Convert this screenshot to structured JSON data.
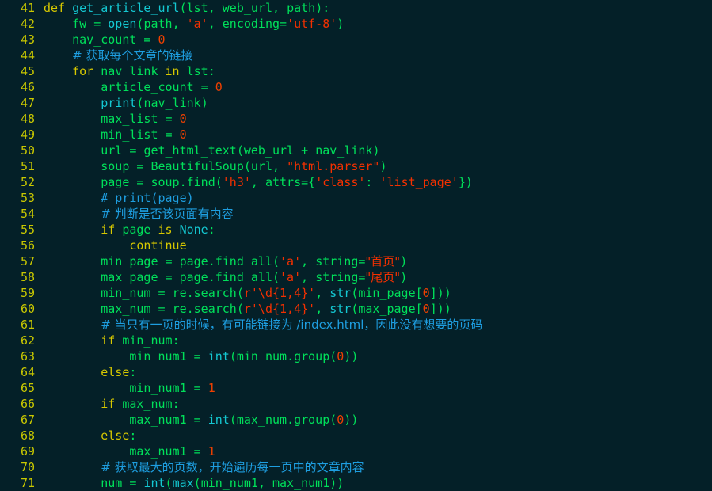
{
  "editor": {
    "background": "#042028",
    "language": "python",
    "first_line_number": 41,
    "last_line_number": 71,
    "palette": {
      "line_number": "#c9c800",
      "keyword": "#d7c800",
      "function": "#14c8d2",
      "identifier": "#00e05a",
      "string": "#f33000",
      "number": "#f04000",
      "comment": "#1e9ee0",
      "background": "#042028"
    },
    "lines": [
      {
        "number": "41",
        "tokens": [
          {
            "t": "def",
            "c": "kw"
          },
          {
            "t": " ",
            "c": "pun"
          },
          {
            "t": "get_article_url",
            "c": "fn"
          },
          {
            "t": "(",
            "c": "pun"
          },
          {
            "t": "lst",
            "c": "id"
          },
          {
            "t": ", ",
            "c": "pun"
          },
          {
            "t": "web_url",
            "c": "id"
          },
          {
            "t": ", ",
            "c": "pun"
          },
          {
            "t": "path",
            "c": "id"
          },
          {
            "t": "):",
            "c": "pun"
          }
        ]
      },
      {
        "number": "42",
        "tokens": [
          {
            "t": "    ",
            "c": "pun"
          },
          {
            "t": "fw",
            "c": "id"
          },
          {
            "t": " = ",
            "c": "op"
          },
          {
            "t": "open",
            "c": "bi"
          },
          {
            "t": "(",
            "c": "pun"
          },
          {
            "t": "path",
            "c": "id"
          },
          {
            "t": ", ",
            "c": "pun"
          },
          {
            "t": "'a'",
            "c": "str"
          },
          {
            "t": ", ",
            "c": "pun"
          },
          {
            "t": "encoding",
            "c": "id"
          },
          {
            "t": "=",
            "c": "op"
          },
          {
            "t": "'utf-8'",
            "c": "str"
          },
          {
            "t": ")",
            "c": "pun"
          }
        ]
      },
      {
        "number": "43",
        "tokens": [
          {
            "t": "    ",
            "c": "pun"
          },
          {
            "t": "nav_count",
            "c": "id"
          },
          {
            "t": " = ",
            "c": "op"
          },
          {
            "t": "0",
            "c": "num"
          }
        ]
      },
      {
        "number": "44",
        "tokens": [
          {
            "t": "    ",
            "c": "pun"
          },
          {
            "t": "# 获取每个文章的链接",
            "c": "com"
          }
        ]
      },
      {
        "number": "45",
        "tokens": [
          {
            "t": "    ",
            "c": "pun"
          },
          {
            "t": "for",
            "c": "kw"
          },
          {
            "t": " ",
            "c": "pun"
          },
          {
            "t": "nav_link",
            "c": "id"
          },
          {
            "t": " ",
            "c": "pun"
          },
          {
            "t": "in",
            "c": "kw"
          },
          {
            "t": " ",
            "c": "pun"
          },
          {
            "t": "lst",
            "c": "id"
          },
          {
            "t": ":",
            "c": "pun"
          }
        ]
      },
      {
        "number": "46",
        "tokens": [
          {
            "t": "        ",
            "c": "pun"
          },
          {
            "t": "article_count",
            "c": "id"
          },
          {
            "t": " = ",
            "c": "op"
          },
          {
            "t": "0",
            "c": "num"
          }
        ]
      },
      {
        "number": "47",
        "tokens": [
          {
            "t": "        ",
            "c": "pun"
          },
          {
            "t": "print",
            "c": "bi"
          },
          {
            "t": "(",
            "c": "pun"
          },
          {
            "t": "nav_link",
            "c": "id"
          },
          {
            "t": ")",
            "c": "pun"
          }
        ]
      },
      {
        "number": "48",
        "tokens": [
          {
            "t": "        ",
            "c": "pun"
          },
          {
            "t": "max_list",
            "c": "id"
          },
          {
            "t": " = ",
            "c": "op"
          },
          {
            "t": "0",
            "c": "num"
          }
        ]
      },
      {
        "number": "49",
        "tokens": [
          {
            "t": "        ",
            "c": "pun"
          },
          {
            "t": "min_list",
            "c": "id"
          },
          {
            "t": " = ",
            "c": "op"
          },
          {
            "t": "0",
            "c": "num"
          }
        ]
      },
      {
        "number": "50",
        "tokens": [
          {
            "t": "        ",
            "c": "pun"
          },
          {
            "t": "url",
            "c": "id"
          },
          {
            "t": " = ",
            "c": "op"
          },
          {
            "t": "get_html_text",
            "c": "id"
          },
          {
            "t": "(",
            "c": "pun"
          },
          {
            "t": "web_url",
            "c": "id"
          },
          {
            "t": " + ",
            "c": "op"
          },
          {
            "t": "nav_link",
            "c": "id"
          },
          {
            "t": ")",
            "c": "pun"
          }
        ]
      },
      {
        "number": "51",
        "tokens": [
          {
            "t": "        ",
            "c": "pun"
          },
          {
            "t": "soup",
            "c": "id"
          },
          {
            "t": " = ",
            "c": "op"
          },
          {
            "t": "BeautifulSoup",
            "c": "id"
          },
          {
            "t": "(",
            "c": "pun"
          },
          {
            "t": "url",
            "c": "id"
          },
          {
            "t": ", ",
            "c": "pun"
          },
          {
            "t": "\"html.parser\"",
            "c": "str"
          },
          {
            "t": ")",
            "c": "pun"
          }
        ]
      },
      {
        "number": "52",
        "tokens": [
          {
            "t": "        ",
            "c": "pun"
          },
          {
            "t": "page",
            "c": "id"
          },
          {
            "t": " = ",
            "c": "op"
          },
          {
            "t": "soup",
            "c": "id"
          },
          {
            "t": ".",
            "c": "pun"
          },
          {
            "t": "find",
            "c": "id"
          },
          {
            "t": "(",
            "c": "pun"
          },
          {
            "t": "'h3'",
            "c": "str"
          },
          {
            "t": ", ",
            "c": "pun"
          },
          {
            "t": "attrs",
            "c": "id"
          },
          {
            "t": "={",
            "c": "op"
          },
          {
            "t": "'class'",
            "c": "str"
          },
          {
            "t": ": ",
            "c": "pun"
          },
          {
            "t": "'list_page'",
            "c": "str"
          },
          {
            "t": "})",
            "c": "pun"
          }
        ]
      },
      {
        "number": "53",
        "tokens": [
          {
            "t": "        ",
            "c": "pun"
          },
          {
            "t": "# print(page)",
            "c": "com"
          }
        ]
      },
      {
        "number": "54",
        "tokens": [
          {
            "t": "        ",
            "c": "pun"
          },
          {
            "t": "# 判断是否该页面有内容",
            "c": "com"
          }
        ]
      },
      {
        "number": "55",
        "tokens": [
          {
            "t": "        ",
            "c": "pun"
          },
          {
            "t": "if",
            "c": "kw"
          },
          {
            "t": " ",
            "c": "pun"
          },
          {
            "t": "page",
            "c": "id"
          },
          {
            "t": " ",
            "c": "pun"
          },
          {
            "t": "is",
            "c": "kw"
          },
          {
            "t": " ",
            "c": "pun"
          },
          {
            "t": "None",
            "c": "bi"
          },
          {
            "t": ":",
            "c": "pun"
          }
        ]
      },
      {
        "number": "56",
        "tokens": [
          {
            "t": "            ",
            "c": "pun"
          },
          {
            "t": "continue",
            "c": "kw"
          }
        ]
      },
      {
        "number": "57",
        "tokens": [
          {
            "t": "        ",
            "c": "pun"
          },
          {
            "t": "min_page",
            "c": "id"
          },
          {
            "t": " = ",
            "c": "op"
          },
          {
            "t": "page",
            "c": "id"
          },
          {
            "t": ".",
            "c": "pun"
          },
          {
            "t": "find_all",
            "c": "id"
          },
          {
            "t": "(",
            "c": "pun"
          },
          {
            "t": "'a'",
            "c": "str"
          },
          {
            "t": ", ",
            "c": "pun"
          },
          {
            "t": "string",
            "c": "id"
          },
          {
            "t": "=",
            "c": "op"
          },
          {
            "t": "\"首页\"",
            "c": "str"
          },
          {
            "t": ")",
            "c": "pun"
          }
        ]
      },
      {
        "number": "58",
        "tokens": [
          {
            "t": "        ",
            "c": "pun"
          },
          {
            "t": "max_page",
            "c": "id"
          },
          {
            "t": " = ",
            "c": "op"
          },
          {
            "t": "page",
            "c": "id"
          },
          {
            "t": ".",
            "c": "pun"
          },
          {
            "t": "find_all",
            "c": "id"
          },
          {
            "t": "(",
            "c": "pun"
          },
          {
            "t": "'a'",
            "c": "str"
          },
          {
            "t": ", ",
            "c": "pun"
          },
          {
            "t": "string",
            "c": "id"
          },
          {
            "t": "=",
            "c": "op"
          },
          {
            "t": "\"尾页\"",
            "c": "str"
          },
          {
            "t": ")",
            "c": "pun"
          }
        ]
      },
      {
        "number": "59",
        "tokens": [
          {
            "t": "        ",
            "c": "pun"
          },
          {
            "t": "min_num",
            "c": "id"
          },
          {
            "t": " = ",
            "c": "op"
          },
          {
            "t": "re",
            "c": "id"
          },
          {
            "t": ".",
            "c": "pun"
          },
          {
            "t": "search",
            "c": "id"
          },
          {
            "t": "(",
            "c": "pun"
          },
          {
            "t": "r'\\d{1,4}'",
            "c": "str"
          },
          {
            "t": ", ",
            "c": "pun"
          },
          {
            "t": "str",
            "c": "bi"
          },
          {
            "t": "(",
            "c": "pun"
          },
          {
            "t": "min_page",
            "c": "id"
          },
          {
            "t": "[",
            "c": "pun"
          },
          {
            "t": "0",
            "c": "num"
          },
          {
            "t": "]))",
            "c": "pun"
          }
        ]
      },
      {
        "number": "60",
        "tokens": [
          {
            "t": "        ",
            "c": "pun"
          },
          {
            "t": "max_num",
            "c": "id"
          },
          {
            "t": " = ",
            "c": "op"
          },
          {
            "t": "re",
            "c": "id"
          },
          {
            "t": ".",
            "c": "pun"
          },
          {
            "t": "search",
            "c": "id"
          },
          {
            "t": "(",
            "c": "pun"
          },
          {
            "t": "r'\\d{1,4}'",
            "c": "str"
          },
          {
            "t": ", ",
            "c": "pun"
          },
          {
            "t": "str",
            "c": "bi"
          },
          {
            "t": "(",
            "c": "pun"
          },
          {
            "t": "max_page",
            "c": "id"
          },
          {
            "t": "[",
            "c": "pun"
          },
          {
            "t": "0",
            "c": "num"
          },
          {
            "t": "]))",
            "c": "pun"
          }
        ]
      },
      {
        "number": "61",
        "tokens": [
          {
            "t": "        ",
            "c": "pun"
          },
          {
            "t": "# 当只有一页的时候，有可能链接为 /index.html，因此没有想要的页码",
            "c": "com"
          }
        ]
      },
      {
        "number": "62",
        "tokens": [
          {
            "t": "        ",
            "c": "pun"
          },
          {
            "t": "if",
            "c": "kw"
          },
          {
            "t": " ",
            "c": "pun"
          },
          {
            "t": "min_num",
            "c": "id"
          },
          {
            "t": ":",
            "c": "pun"
          }
        ]
      },
      {
        "number": "63",
        "tokens": [
          {
            "t": "            ",
            "c": "pun"
          },
          {
            "t": "min_num1",
            "c": "id"
          },
          {
            "t": " = ",
            "c": "op"
          },
          {
            "t": "int",
            "c": "bi"
          },
          {
            "t": "(",
            "c": "pun"
          },
          {
            "t": "min_num",
            "c": "id"
          },
          {
            "t": ".",
            "c": "pun"
          },
          {
            "t": "group",
            "c": "id"
          },
          {
            "t": "(",
            "c": "pun"
          },
          {
            "t": "0",
            "c": "num"
          },
          {
            "t": "))",
            "c": "pun"
          }
        ]
      },
      {
        "number": "64",
        "tokens": [
          {
            "t": "        ",
            "c": "pun"
          },
          {
            "t": "else",
            "c": "kw"
          },
          {
            "t": ":",
            "c": "pun"
          }
        ]
      },
      {
        "number": "65",
        "tokens": [
          {
            "t": "            ",
            "c": "pun"
          },
          {
            "t": "min_num1",
            "c": "id"
          },
          {
            "t": " = ",
            "c": "op"
          },
          {
            "t": "1",
            "c": "num"
          }
        ]
      },
      {
        "number": "66",
        "tokens": [
          {
            "t": "        ",
            "c": "pun"
          },
          {
            "t": "if",
            "c": "kw"
          },
          {
            "t": " ",
            "c": "pun"
          },
          {
            "t": "max_num",
            "c": "id"
          },
          {
            "t": ":",
            "c": "pun"
          }
        ]
      },
      {
        "number": "67",
        "tokens": [
          {
            "t": "            ",
            "c": "pun"
          },
          {
            "t": "max_num1",
            "c": "id"
          },
          {
            "t": " = ",
            "c": "op"
          },
          {
            "t": "int",
            "c": "bi"
          },
          {
            "t": "(",
            "c": "pun"
          },
          {
            "t": "max_num",
            "c": "id"
          },
          {
            "t": ".",
            "c": "pun"
          },
          {
            "t": "group",
            "c": "id"
          },
          {
            "t": "(",
            "c": "pun"
          },
          {
            "t": "0",
            "c": "num"
          },
          {
            "t": "))",
            "c": "pun"
          }
        ]
      },
      {
        "number": "68",
        "tokens": [
          {
            "t": "        ",
            "c": "pun"
          },
          {
            "t": "else",
            "c": "kw"
          },
          {
            "t": ":",
            "c": "pun"
          }
        ]
      },
      {
        "number": "69",
        "tokens": [
          {
            "t": "            ",
            "c": "pun"
          },
          {
            "t": "max_num1",
            "c": "id"
          },
          {
            "t": " = ",
            "c": "op"
          },
          {
            "t": "1",
            "c": "num"
          }
        ]
      },
      {
        "number": "70",
        "tokens": [
          {
            "t": "        ",
            "c": "pun"
          },
          {
            "t": "# 获取最大的页数，开始遍历每一页中的文章内容",
            "c": "com"
          }
        ]
      },
      {
        "number": "71",
        "tokens": [
          {
            "t": "        ",
            "c": "pun"
          },
          {
            "t": "num",
            "c": "id"
          },
          {
            "t": " = ",
            "c": "op"
          },
          {
            "t": "int",
            "c": "bi"
          },
          {
            "t": "(",
            "c": "pun"
          },
          {
            "t": "max",
            "c": "bi"
          },
          {
            "t": "(",
            "c": "pun"
          },
          {
            "t": "min_num1",
            "c": "id"
          },
          {
            "t": ", ",
            "c": "pun"
          },
          {
            "t": "max_num1",
            "c": "id"
          },
          {
            "t": "))",
            "c": "pun"
          }
        ]
      }
    ]
  }
}
